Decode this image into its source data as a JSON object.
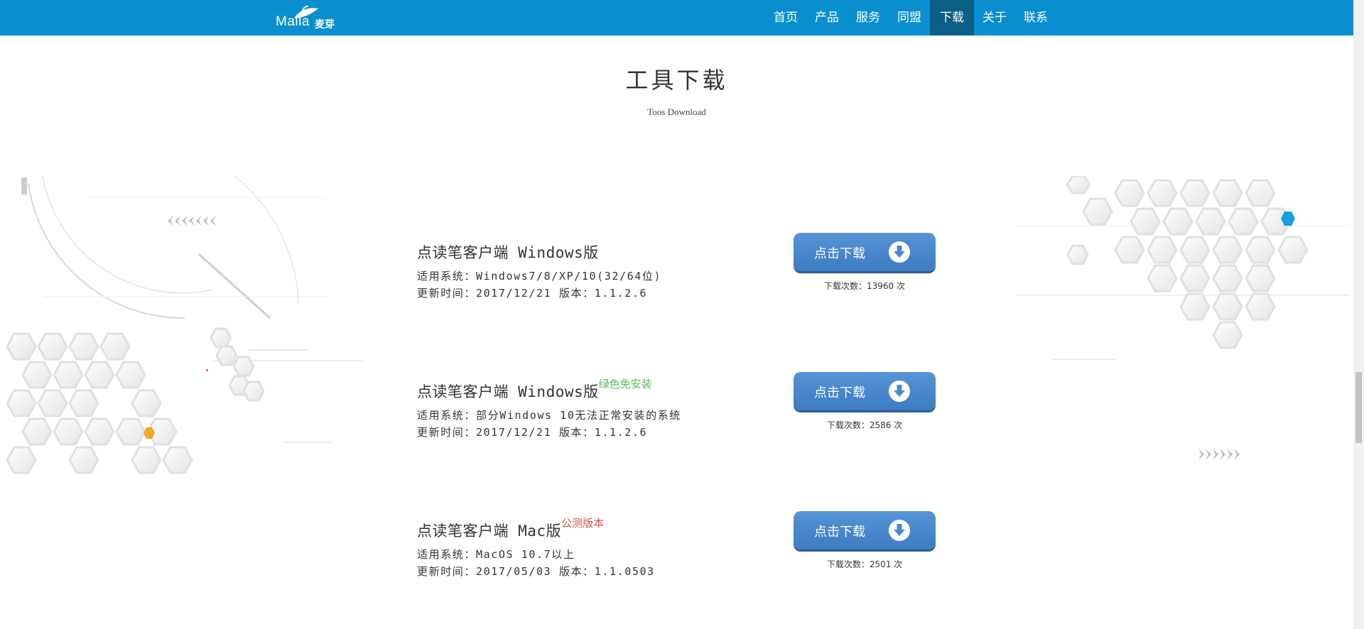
{
  "brand": {
    "logo_text": "Maila",
    "logo_cn": "麦芽"
  },
  "nav": {
    "items": [
      "首页",
      "产品",
      "服务",
      "同盟",
      "下载",
      "关于",
      "联系"
    ],
    "active": "下载"
  },
  "page": {
    "title": "工具下载",
    "subtitle": "Toos Download"
  },
  "downloads": [
    {
      "title": "点读笔客户端 Windows版",
      "tag": "",
      "system": "适用系统：Windows7/8/XP/10(32/64位)",
      "update": "更新时间：2017/12/21 版本：1.1.2.6",
      "button": "点击下载",
      "count": "下载次数：13960 次"
    },
    {
      "title": "点读笔客户端 Windows版",
      "tag": "绿色免安装",
      "system": "适用系统：部分Windows 10无法正常安装的系统",
      "update": "更新时间：2017/12/21 版本：1.1.2.6",
      "button": "点击下载",
      "count": "下载次数：2586 次"
    },
    {
      "title": "点读笔客户端 Mac版",
      "tag": "公测版本",
      "system": "适用系统：MacOS 10.7以上",
      "update": "更新时间：2017/05/03 版本：1.1.0503",
      "button": "点击下载",
      "count": "下载次数：2501 次"
    }
  ],
  "icons": {
    "download": "download-circle-icon",
    "arrows_left": "chevrons-left-icon",
    "arrows_right": "chevrons-right-icon"
  },
  "colors": {
    "nav_bg": "#0a8fce",
    "nav_active": "#0b5f86",
    "button": "#4a88cc",
    "tag_green": "#5cb85c",
    "tag_red": "#d9534f",
    "hex_orange": "#f5a623",
    "hex_blue": "#1a9be0"
  }
}
